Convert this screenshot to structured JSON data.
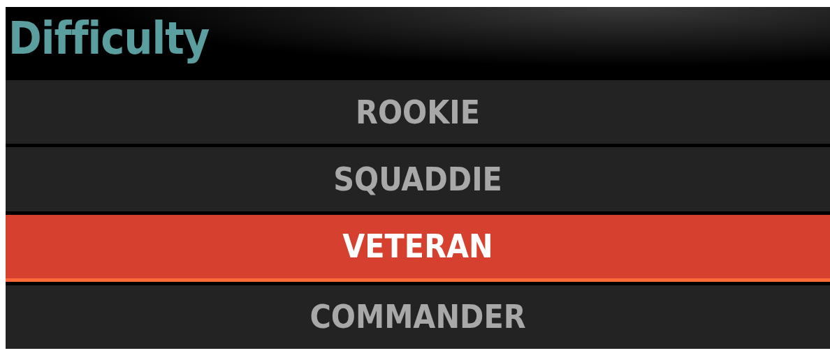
{
  "title": "Difficulty",
  "options": [
    {
      "label": "ROOKIE",
      "selected": false
    },
    {
      "label": "SQUADDIE",
      "selected": false
    },
    {
      "label": "VETERAN",
      "selected": true
    },
    {
      "label": "COMMANDER",
      "selected": false
    }
  ]
}
